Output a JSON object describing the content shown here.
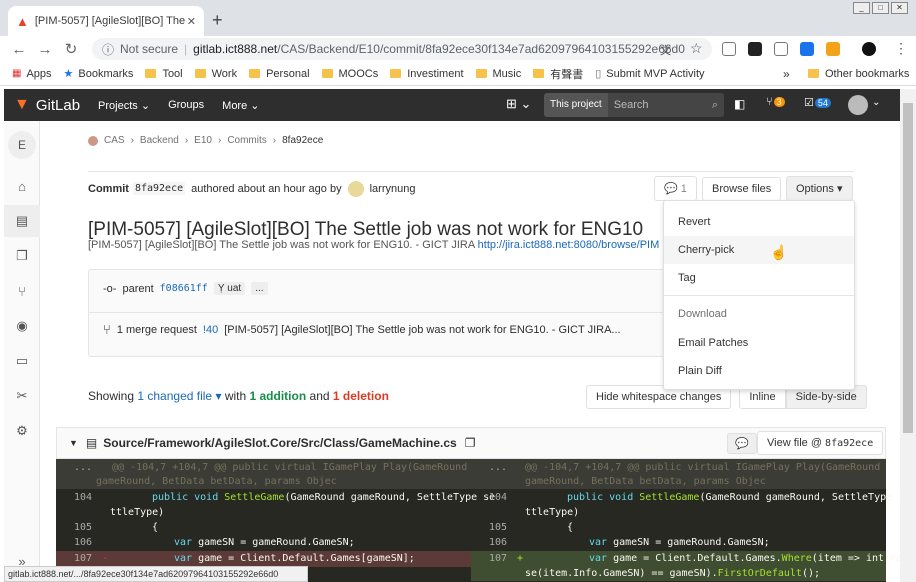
{
  "browser": {
    "tab_title": "[PIM-5057] [AgileSlot][BO] The S",
    "new_tab": "+",
    "security": "Not secure",
    "url_host": "gitlab.ict888.net",
    "url_path": "/CAS/Backend/E10/commit/8fa92ece30f134e7ad62097964103155292e66d0",
    "status_url": "gitlab.ict888.net/.../8fa92ece30f134e7ad62097964103155292e66d0"
  },
  "bookmarks": {
    "items": [
      "Apps",
      "Bookmarks",
      "Tool",
      "Work",
      "Personal",
      "MOOCs",
      "Investiment",
      "Music",
      "有聲書",
      "Submit MVP Activity"
    ],
    "more": "»",
    "other": "Other bookmarks"
  },
  "gitlab_nav": {
    "logo": "GitLab",
    "projects": "Projects",
    "groups": "Groups",
    "more": "More",
    "this_project": "This project",
    "search_placeholder": "Search",
    "mr_count": "3",
    "todo_count": "54",
    "brand_color": "#2e2e2e"
  },
  "sidebar": {
    "avatar_letter": "E",
    "items": [
      "home-icon",
      "file-icon",
      "copy-icon",
      "merge-icon",
      "issue-icon",
      "clipboard-icon",
      "scissors-icon",
      "gear-icon"
    ],
    "collapse": "»"
  },
  "breadcrumb": {
    "items": [
      "CAS",
      "Backend",
      "E10",
      "Commits"
    ],
    "current": "8fa92ece",
    "sep": "›"
  },
  "commit": {
    "label": "Commit",
    "sha_short": "8fa92ece",
    "authored": "authored about an hour ago by",
    "author": "larrynung",
    "comment_count": "1",
    "browse_files": "Browse files",
    "options": "Options",
    "title": "[PIM-5057] [AgileSlot][BO] The Settle job was not work for ENG10",
    "description": "[PIM-5057] [AgileSlot][BO] The Settle job was not work for ENG10. - GICT JIRA",
    "description_link": "http://jira.ict888.net:8080/browse/PIM",
    "parent_label": "parent",
    "parent_sha": "f08661ff",
    "branch": "uat",
    "ellipsis": "...",
    "mr_prefix": "1 merge request",
    "mr_id": "!40",
    "mr_title": "[PIM-5057] [AgileSlot][BO] The Settle job was not work for ENG10. - GICT JIRA..."
  },
  "options_menu": {
    "revert": "Revert",
    "cherry_pick": "Cherry-pick",
    "tag": "Tag",
    "download_header": "Download",
    "email_patches": "Email Patches",
    "plain_diff": "Plain Diff"
  },
  "changes": {
    "showing": "Showing",
    "changed_file": "1 changed file",
    "with": "with",
    "additions": "1 addition",
    "and": "and",
    "deletions": "1 deletion",
    "hide_whitespace": "Hide whitespace changes",
    "inline": "Inline",
    "side_by_side": "Side-by-side"
  },
  "file": {
    "path": "Source/Framework/AgileSlot.Core/Src/Class/GameMachine.cs",
    "view_file": "View file @",
    "view_sha": "8fa92ece"
  },
  "diff": {
    "hunk_left": "@@ -104,7 +104,7 @@ public virtual IGamePlay Play(GameRound",
    "hunk_left2": "gameRound, BetData betData, params Objec",
    "hunk_right": "@@ -104,7 +104,7 @@ public virtual IGamePlay Play(GameRound",
    "hunk_right2": "gameRound, BetData betData, params Objec",
    "dots": "...",
    "lines": [
      "104",
      "105",
      "106",
      "107"
    ],
    "l104a": "public void ",
    "l104fn": "SettleGame",
    "l104b": "(GameRound gameRound, SettleType se",
    "l104c": "ttleType)",
    "l105": "{",
    "l106kw": "var",
    "l106": " gameSN = gameRound.GameSN;",
    "l107kw": "var",
    "l107_left": " game = Client.Default.Games[gameSN];",
    "l107_right_a": " game = Client.Default.Games.",
    "l107_right_fn": "Where",
    "l107_right_b": "(item => int.Par",
    "l107_right_c": "se(item.Info.GameSN) == gameSN).",
    "l107_right_fn2": "FirstOrDefault",
    "l107_right_d": "();",
    "minus": "-",
    "plus": "+"
  }
}
